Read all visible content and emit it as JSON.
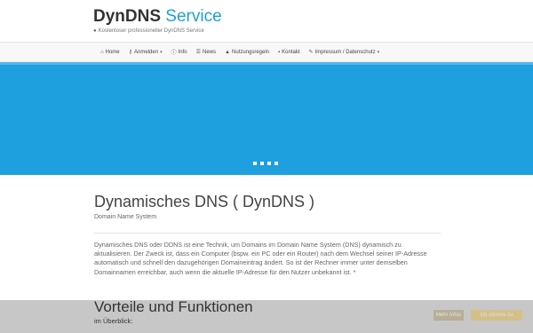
{
  "brand": {
    "part1": "DynDNS",
    "part2": "Service",
    "tagline": "Kostenloser professioneller DynDNS Service"
  },
  "nav": [
    {
      "icon": "home-icon",
      "glyph": "⌂",
      "label": "Home",
      "caret": false
    },
    {
      "icon": "key-icon",
      "glyph": "⚷",
      "label": "Anmelden",
      "caret": true
    },
    {
      "icon": "info-icon",
      "glyph": "ⓘ",
      "label": "Info",
      "caret": false
    },
    {
      "icon": "list-icon",
      "glyph": "☰",
      "label": "News",
      "caret": false
    },
    {
      "icon": "warning-icon",
      "glyph": "▲",
      "label": "Nutzungsregeln",
      "caret": false
    },
    {
      "icon": "contact-icon",
      "glyph": "▪",
      "label": "Kontakt",
      "caret": false
    },
    {
      "icon": "wrench-icon",
      "glyph": "✎",
      "label": "Impressum / Datenschutz",
      "caret": true
    }
  ],
  "slider": {
    "slide_count": 4
  },
  "main": {
    "title": "Dynamisches DNS ( DynDNS )",
    "subtitle": "Domain Name System",
    "paragraph": "Dynamisches DNS oder DDNS ist eine Technik, um Domains im Domain Name System (DNS) dynamisch zu aktualisieren. Der Zweck ist, dass ein Computer (bspw. ein PC oder ein Router) nach dem Wechsel seiner IP-Adresse automatisch und schnell den dazugehörigen Domaineintrag ändert. So ist der Rechner immer unter demselben Domainnamen erreichbar, auch wenn die aktuelle IP-Adresse für den Nutzer unbekannt ist. *",
    "section_title": "Vorteile und Funktionen",
    "section_sub": "im Überblick:"
  },
  "cookie": {
    "btn_more": "Mehr Infos",
    "btn_accept": "Ich stimme zu"
  },
  "colors": {
    "brand_blue": "#1e9fde",
    "hero_bg": "#1e9fde"
  }
}
